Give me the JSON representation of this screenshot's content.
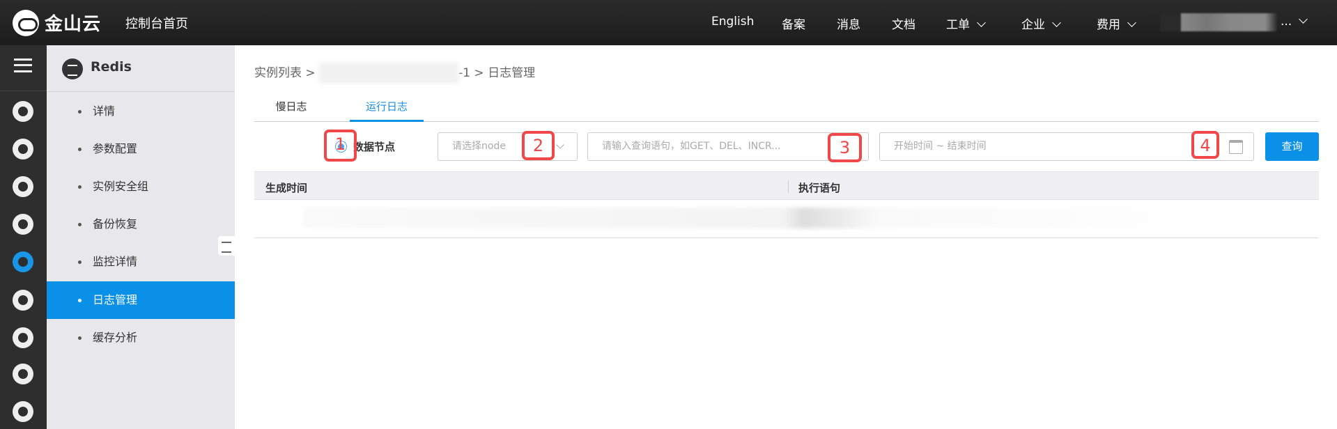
{
  "header": {
    "logo_text": "金山云",
    "home_link": "控制台首页",
    "nav": [
      {
        "label": "English"
      },
      {
        "label": "备案"
      },
      {
        "label": "消息"
      },
      {
        "label": "文档"
      },
      {
        "label": "工单",
        "dropdown": true
      },
      {
        "label": "企业",
        "dropdown": true
      },
      {
        "label": "费用",
        "dropdown": true
      }
    ],
    "user_ellipsis": "..."
  },
  "iconbar": [
    "menu-icon",
    "cloud-host-icon",
    "database-icon",
    "postgresql-icon",
    "sqlserver-icon",
    "redis-icon",
    "mongodb-icon",
    "memcache-icon",
    "kafka-icon",
    "monitor-icon"
  ],
  "sidebar": {
    "title": "Redis",
    "items": [
      {
        "label": "详情"
      },
      {
        "label": "参数配置"
      },
      {
        "label": "实例安全组"
      },
      {
        "label": "备份恢复"
      },
      {
        "label": "监控详情"
      },
      {
        "label": "日志管理",
        "active": true
      },
      {
        "label": "缓存分析"
      }
    ]
  },
  "breadcrumb": {
    "root": "实例列表",
    "sep": ">",
    "instance_tail": "-1",
    "current": "日志管理"
  },
  "tabs": [
    {
      "label": "慢日志"
    },
    {
      "label": "运行日志",
      "active": true
    }
  ],
  "filters": {
    "radio_label": "数据节点",
    "node_placeholder": "请选择node",
    "query_placeholder": "请输入查询语句，如GET、DEL、INCR...",
    "time_placeholder": "开始时间 ~ 结束时间",
    "query_button": "查询"
  },
  "table": {
    "columns": [
      "生成时间",
      "执行语句"
    ]
  },
  "annotations": [
    "1",
    "2",
    "3",
    "4"
  ],
  "colors": {
    "accent": "#0a90e6",
    "annotation": "#f04848",
    "header_bg": "#232323"
  }
}
